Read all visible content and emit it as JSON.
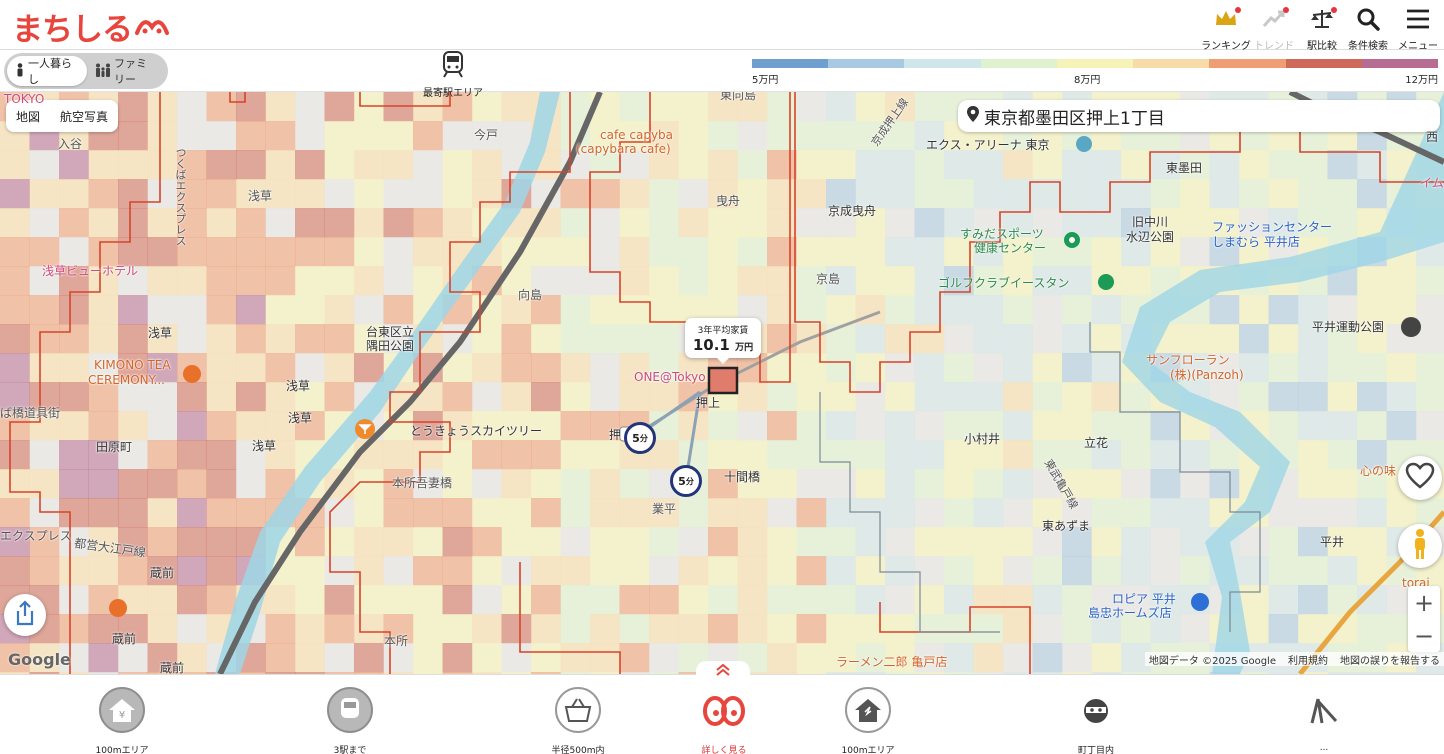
{
  "header": {
    "logo": "まちしる",
    "nav": [
      {
        "label": "ランキング",
        "icon": "crown-icon",
        "dot": true
      },
      {
        "label": "トレンド",
        "icon": "trend-icon",
        "dot": true
      },
      {
        "label": "駅比較",
        "icon": "scale-icon",
        "dot": true
      },
      {
        "label": "条件検索",
        "icon": "search-icon",
        "dot": false
      },
      {
        "label": "メニュー",
        "icon": "menu-icon",
        "dot": false
      }
    ]
  },
  "subbar": {
    "toggle": {
      "single": "一人暮らし",
      "family": "ファミリー"
    },
    "nearest_station": "最寄駅エリア",
    "legend": {
      "ticks": [
        "5万円",
        "8万円",
        "12万円"
      ],
      "colors": [
        "#6e9fcf",
        "#a8c9e2",
        "#cfe6ea",
        "#dff2cf",
        "#f6f3b8",
        "#f7dca9",
        "#ef9d74",
        "#cf6a5b",
        "#b76d93"
      ]
    }
  },
  "map": {
    "tabs": [
      "地図",
      "航空写真"
    ],
    "address": "東京都墨田区押上1丁目",
    "callout": {
      "title": "3年平均家賃",
      "value": "10.1",
      "unit": "万円"
    },
    "badges": [
      "5",
      "5"
    ],
    "badge_unit": "分",
    "labels": {
      "tokyo": "TOKYO",
      "iriya": "入谷",
      "tsukuba": "つくばエクスプレス",
      "asakusa": "浅草",
      "asakusa_view": "浅草ビューホテル",
      "kimono": "KIMONO TEA",
      "ceremony": "CEREMONY...",
      "dogu": "ば橋道具街",
      "tawaramachi": "田原町",
      "asakusa2": "浅草",
      "asakusa3": "浅草",
      "asakusa4": "浅草",
      "asakusa5": "浅草",
      "express": "エクスプレス",
      "oedo": "都営大江戸線",
      "kuramae": "蔵前",
      "kuramae2": "蔵前",
      "kuramae3": "蔵前",
      "imado": "今戸",
      "taito": "台東区立",
      "sumida_park": "隅田公園",
      "mukojima": "向島",
      "skytree": "とうきょうスカイツリー",
      "oshiage": "押",
      "honjo": "本所吾妻橋",
      "honjo2": "本所",
      "narihira": "業平",
      "higashimukojima": "東向島",
      "capybara1": "cafe capyba",
      "capybara2": "(capybara cafe)",
      "hikifune": "曳舟",
      "keisei_hikifune": "京成曳舟",
      "keisei_line": "京成押上線",
      "one_tokyo": "ONE@Tokyo",
      "oshiage2": "押上",
      "jukkenbashi": "十間橋",
      "kyojima": "京島",
      "x_arena": "エクス・アリーナ 東京",
      "sumida_sports": "すみだスポーツ",
      "health": "健康センター",
      "golf": "ゴルフクラブイースタン",
      "higashisumida": "東墨田",
      "kyunaka1": "旧中川",
      "kyunaka2": "水辺公園",
      "fashion1": "ファッションセンター",
      "fashion2": "しまむら 平井店",
      "hirai_park": "平井運動公園",
      "sunflo1": "サンフローラン",
      "sunflo2": "(株)(Panzoh)",
      "komurai": "小村井",
      "tatebana": "立花",
      "tobu": "東武亀戸線",
      "higashiazuma": "東あずま",
      "kokoro": "心の味",
      "hirai": "平井",
      "torai": "torai",
      "ropia1": "ロピア 平井",
      "ropia2": "島忠ホームズ店",
      "ramen": "ラーメン二郎 亀戸店",
      "nishi": "西",
      "imu": "イム"
    },
    "attribution": [
      "地図データ ©2025 Google",
      "利用規約",
      "地図の誤りを報告する"
    ],
    "google": "Google"
  },
  "bottom": {
    "items": [
      {
        "label": "100mエリア",
        "icon": "home-yen-icon"
      },
      {
        "label": "3駅まで",
        "icon": "train-icon"
      },
      {
        "label": "半径500m内",
        "icon": "basket-icon"
      },
      {
        "label": "詳しく見る",
        "icon": "eyes-icon"
      },
      {
        "label": "100mエリア",
        "icon": "house-storm-icon"
      },
      {
        "label": "町丁目内",
        "icon": "thief-icon"
      },
      {
        "label": "...",
        "icon": "playground-icon"
      }
    ]
  }
}
